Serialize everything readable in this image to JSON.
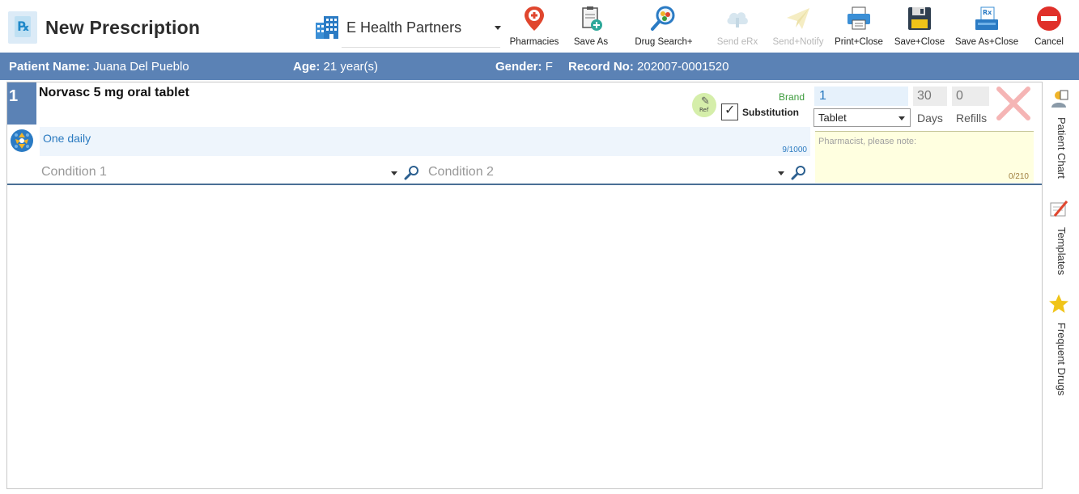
{
  "header": {
    "title": "New Prescription",
    "organization": "E Health Partners"
  },
  "toolbar": {
    "pharmacies": "Pharmacies",
    "save_as": "Save As",
    "drug_search": "Drug Search+",
    "send_erx": "Send eRx",
    "send_notify": "Send+Notify",
    "print_close": "Print+Close",
    "save_close": "Save+Close",
    "save_as_close": "Save As+Close",
    "cancel": "Cancel"
  },
  "patient": {
    "name_label": "Patient Name:",
    "name": "Juana Del Pueblo",
    "age_label": "Age:",
    "age": "21 year(s)",
    "gender_label": "Gender:",
    "gender": "F",
    "record_label": "Record No:",
    "record": "202007-0001520"
  },
  "prescription": {
    "number": "1",
    "drug_name": "Norvasc 5 mg oral tablet",
    "brand_label": "Brand",
    "ref_label": "Ref",
    "substitution_label": "Substitution",
    "substitution_checked": true,
    "quantity": "1",
    "days": "30",
    "refills": "0",
    "form": "Tablet",
    "days_label": "Days",
    "refills_label": "Refills",
    "sig": "One daily",
    "sig_count": "9/1000",
    "pharmacist_note_placeholder": "Pharmacist, please note:",
    "pharmacist_note_count": "0/210",
    "condition1_placeholder": "Condition 1",
    "condition2_placeholder": "Condition 2"
  },
  "side_panel": {
    "patient_chart": "Patient Chart",
    "templates": "Templates",
    "frequent_drugs": "Frequent Drugs"
  },
  "colors": {
    "accent": "#5b82b5",
    "sig_text": "#2a7ac0",
    "brand_green": "#3a9a3a",
    "delete_red": "#f5b5b5"
  }
}
